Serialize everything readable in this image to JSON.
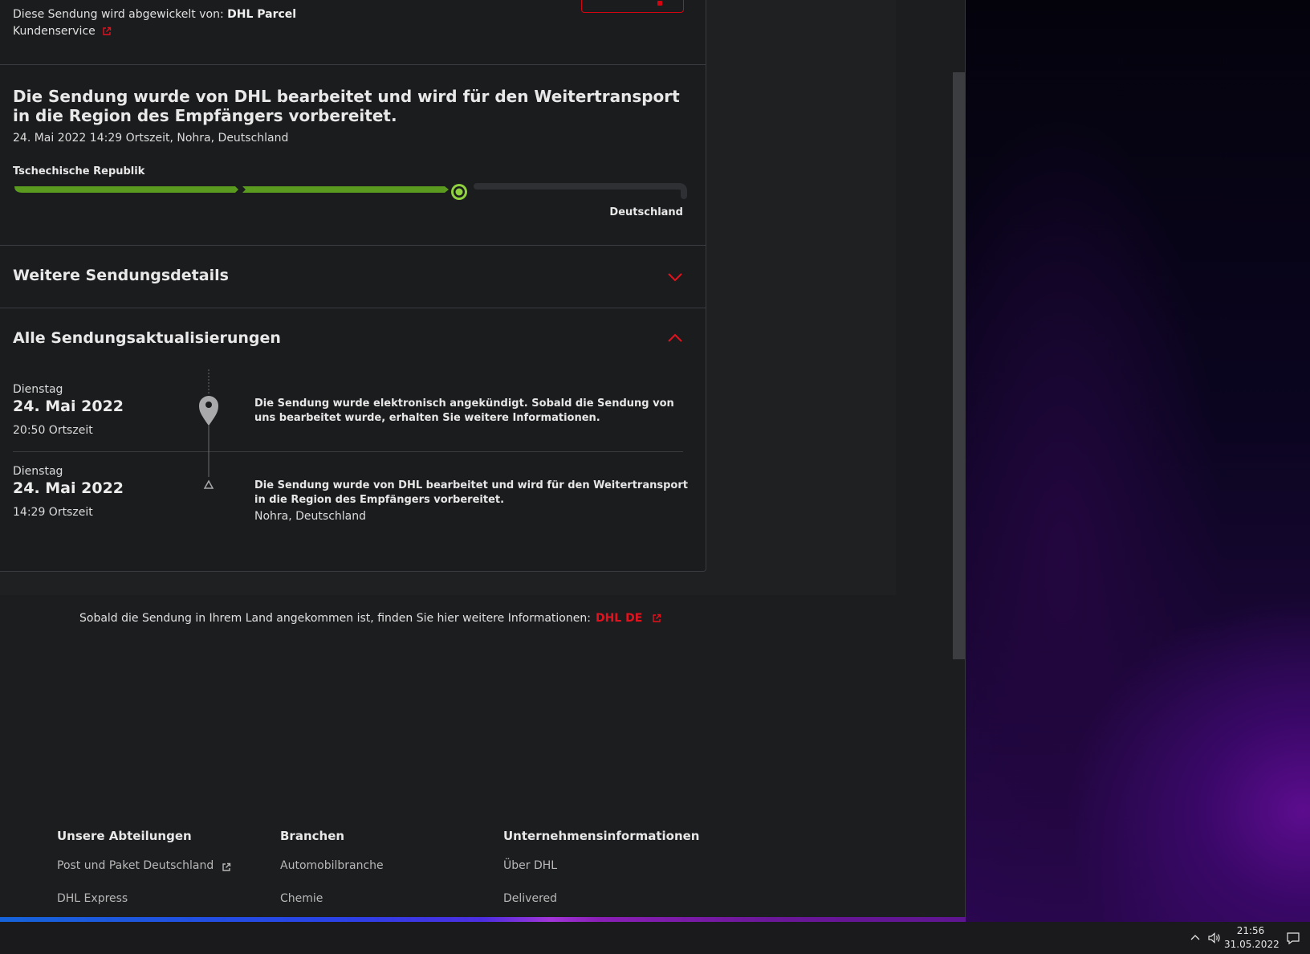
{
  "shipment": {
    "handled_by_prefix": "Diese Sendung wird abgewickelt von:",
    "handled_by_carrier": "DHL Parcel",
    "support_link": "Kundenservice"
  },
  "status": {
    "headline": "Die Sendung wurde von DHL bearbeitet und wird für den Weitertransport in die Region des Empfängers vorbereitet.",
    "meta": "24. Mai 2022 14:29 Ortszeit, Nohra, Deutschland",
    "origin": "Tschechische Republik",
    "destination": "Deutschland",
    "progress_segments_completed": 2,
    "progress_segments_total": 3
  },
  "sections": {
    "more_details": "Weitere Sendungsdetails",
    "all_updates": "Alle Sendungsaktualisierungen"
  },
  "events": [
    {
      "weekday": "Dienstag",
      "date": "24. Mai 2022",
      "time": "20:50 Ortszeit",
      "text": "Die Sendung wurde elektronisch angekündigt. Sobald die Sendung von uns bearbeitet wurde, erhalten Sie weitere Informationen.",
      "location": ""
    },
    {
      "weekday": "Dienstag",
      "date": "24. Mai 2022",
      "time": "14:29 Ortszeit",
      "text": "Die Sendung wurde von DHL bearbeitet und wird für den Weitertransport in die Region des Empfängers vorbereitet.",
      "location": "Nohra, Deutschland"
    }
  ],
  "info": {
    "text": "Sobald die Sendung in Ihrem Land angekommen ist, finden Sie hier weitere Informationen:",
    "link": "DHL DE"
  },
  "footer": {
    "columns": [
      {
        "heading": "Unsere Abteilungen",
        "links": [
          "Post und Paket Deutschland",
          "DHL Express"
        ]
      },
      {
        "heading": "Branchen",
        "links": [
          "Automobilbranche",
          "Chemie"
        ]
      },
      {
        "heading": "Unternehmensinformationen",
        "links": [
          "Über DHL",
          "Delivered"
        ]
      }
    ]
  },
  "taskbar": {
    "time": "21:56",
    "date": "31.05.2022"
  },
  "colors": {
    "accent_red": "#d40511",
    "progress_green": "#5a9a1e",
    "current_marker": "#8fd13f"
  }
}
